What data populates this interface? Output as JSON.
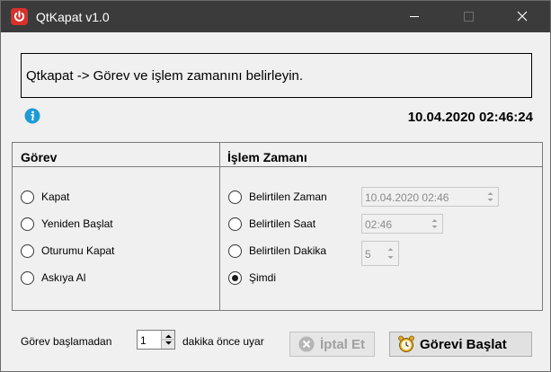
{
  "window": {
    "title": "QtKapat v1.0"
  },
  "header": {
    "text": "Qtkapat -> Görev ve işlem zamanını belirleyin."
  },
  "datetime": "10.04.2020 02:46:24",
  "task_section": {
    "title": "Görev",
    "options": [
      {
        "label": "Kapat",
        "checked": false
      },
      {
        "label": "Yeniden Başlat",
        "checked": false
      },
      {
        "label": "Oturumu Kapat",
        "checked": false
      },
      {
        "label": "Askıya Al",
        "checked": false
      }
    ]
  },
  "time_section": {
    "title": "İşlem Zamanı",
    "options": [
      {
        "label": "Belirtilen Zaman",
        "checked": false,
        "value": "10.04.2020 02:46"
      },
      {
        "label": "Belirtilen Saat",
        "checked": false,
        "value": "02:46"
      },
      {
        "label": "Belirtilen Dakika",
        "checked": false,
        "value": "5"
      },
      {
        "label": "Şimdi",
        "checked": true
      }
    ]
  },
  "bottom": {
    "before_label": "Görev başlamadan",
    "reminder_value": "1",
    "after_label": "dakika önce uyar",
    "cancel_label": "İptal Et",
    "start_label": "Görevi Başlat"
  },
  "icons": {
    "app": "power-icon",
    "info": "info-icon",
    "cancel": "cancel-circle-icon",
    "start": "alarm-clock-icon"
  },
  "colors": {
    "titlebar": "#3b3b3b",
    "app_icon": "#d9302b",
    "info": "#1e9bd7",
    "alarm": "#e8a820"
  }
}
